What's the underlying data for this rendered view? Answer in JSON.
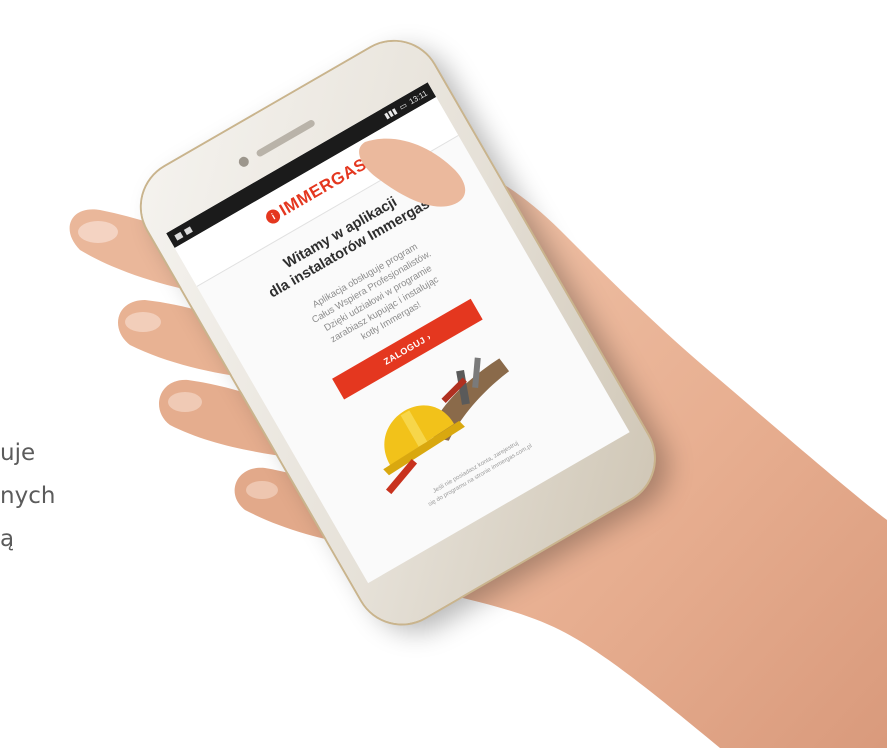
{
  "background_text": {
    "lines": [
      "uje",
      "nych",
      "ą"
    ]
  },
  "phone": {
    "status_bar": {
      "time": "13:11"
    },
    "app": {
      "logo": {
        "mark": "i",
        "text": "IMMERGAS",
        "color": "#e4371f"
      },
      "title_line1": "Witamy w aplikacji",
      "title_line2": "dla instalatorów Immergas",
      "description_lines": [
        "Aplikacja obsługuje program",
        "Całus Wspiera Profesjonalistów.",
        "Dzięki udziałowi w programie",
        "zarabiasz kupując i instalując",
        "kotły Immergas!"
      ],
      "login_button": "ZALOGUJ ›",
      "footnote_lines": [
        "Jeśli nie posiadasz konta, zarejestruj",
        "się do programu na stronie immergas.com.pl"
      ],
      "image_icon": "hardhat-and-tools-icon"
    }
  }
}
